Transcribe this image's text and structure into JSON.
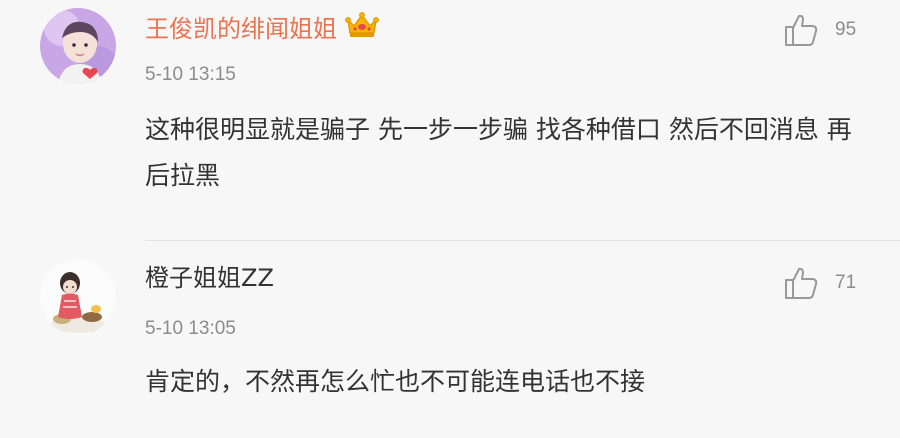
{
  "comments": [
    {
      "username": "王俊凯的绯闻姐姐",
      "time": "5-10 13:15",
      "content": "这种很明显就是骗子 先一步一步骗 找各种借口 然后不回消息 再后拉黑",
      "likes": "95",
      "name_color": "#eb7350",
      "badge_icon": "crown-icon"
    },
    {
      "username": "橙子姐姐ZZ",
      "time": "5-10 13:05",
      "content": "肯定的，不然再怎么忙也不可能连电话也不接",
      "likes": "71"
    }
  ]
}
